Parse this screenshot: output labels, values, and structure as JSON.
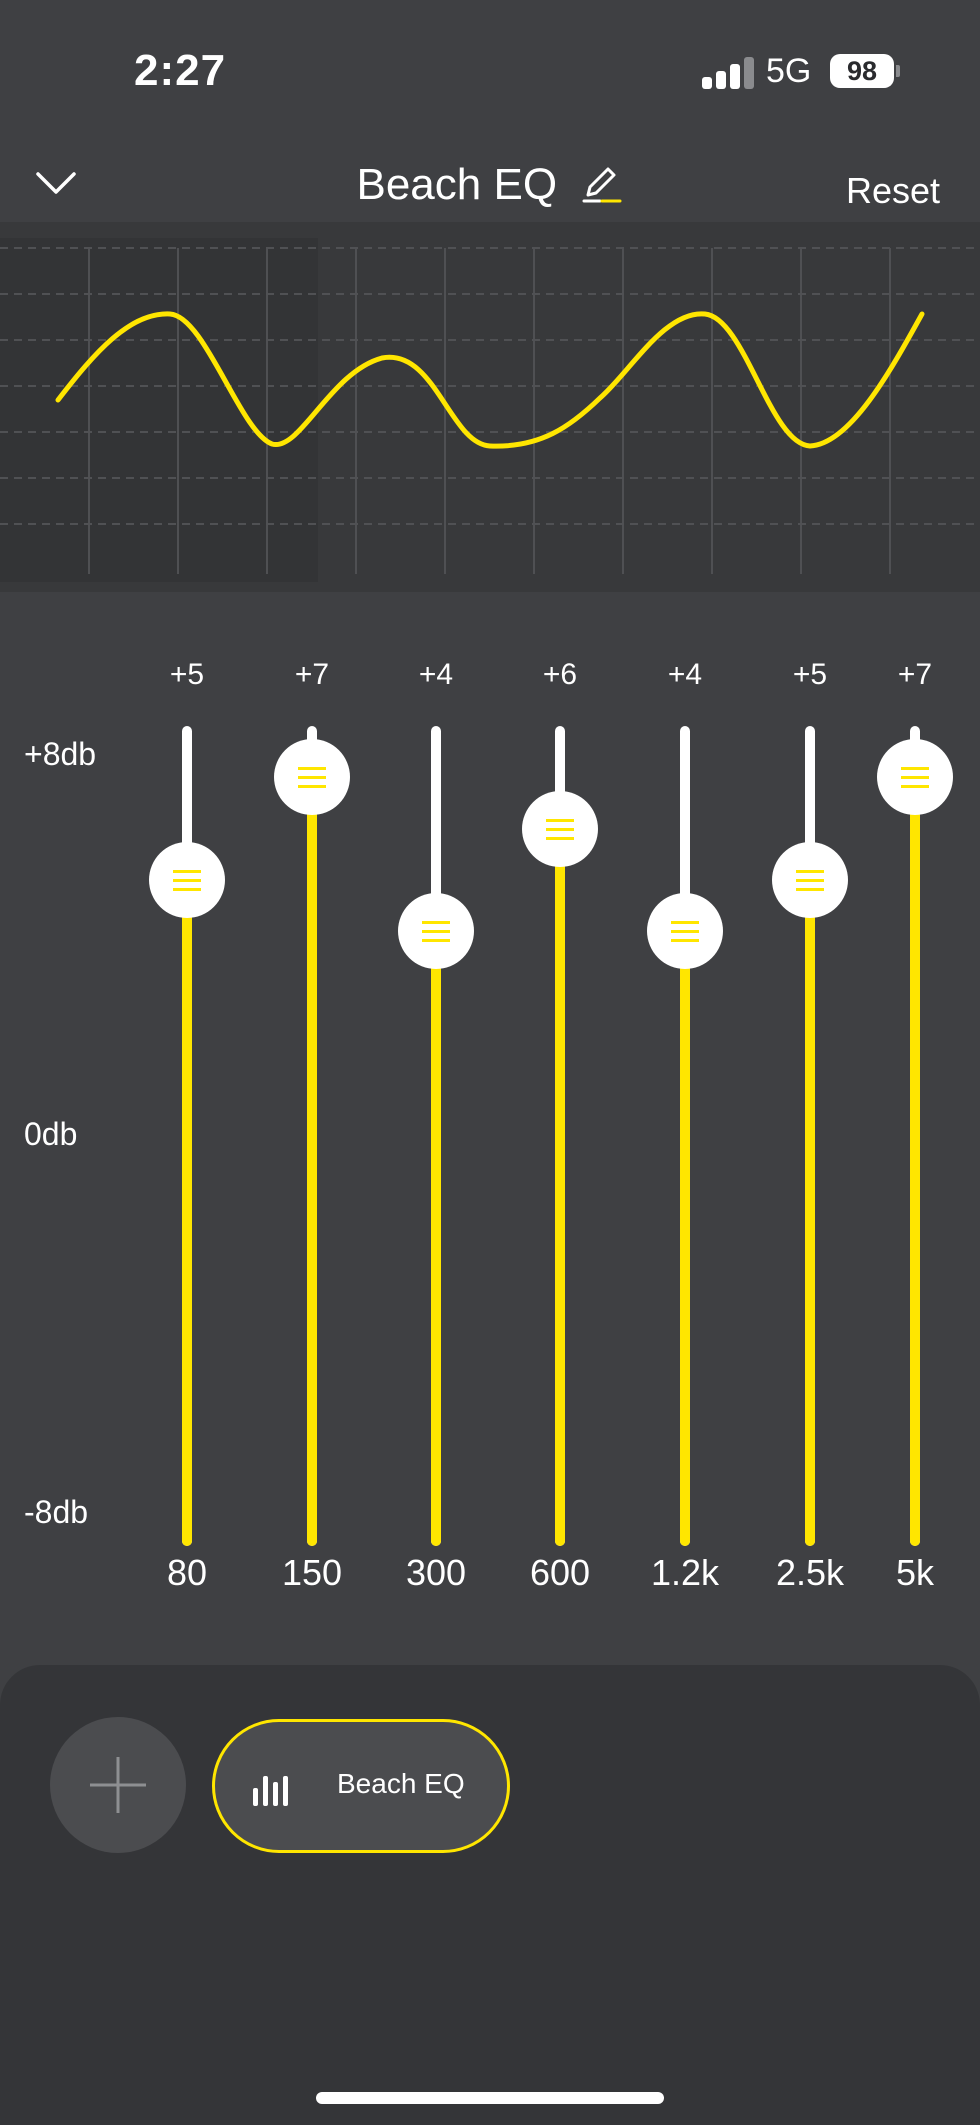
{
  "status_bar": {
    "time": "2:27",
    "network": "5G",
    "battery": "98"
  },
  "header": {
    "title": "Beach EQ",
    "reset_label": "Reset"
  },
  "scale": {
    "top_label": "+8db",
    "mid_label": "0db",
    "bottom_label": "-8db",
    "min_db": -8,
    "max_db": 8
  },
  "bands": [
    {
      "freq": "80",
      "label": "+5",
      "value": 5
    },
    {
      "freq": "150",
      "label": "+7",
      "value": 7
    },
    {
      "freq": "300",
      "label": "+4",
      "value": 4
    },
    {
      "freq": "600",
      "label": "+6",
      "value": 6
    },
    {
      "freq": "1.2k",
      "label": "+4",
      "value": 4
    },
    {
      "freq": "2.5k",
      "label": "+5",
      "value": 5
    },
    {
      "freq": "5k",
      "label": "+7",
      "value": 7
    }
  ],
  "presets": {
    "active": "Beach EQ"
  },
  "colors": {
    "accent": "#ffe600",
    "background": "#3f4043",
    "panel": "#343538",
    "track": "#ffffff"
  },
  "icons": {
    "back": "chevron-down-icon",
    "edit": "pencil-icon",
    "add": "plus-icon",
    "preset": "equalizer-bars-icon"
  }
}
